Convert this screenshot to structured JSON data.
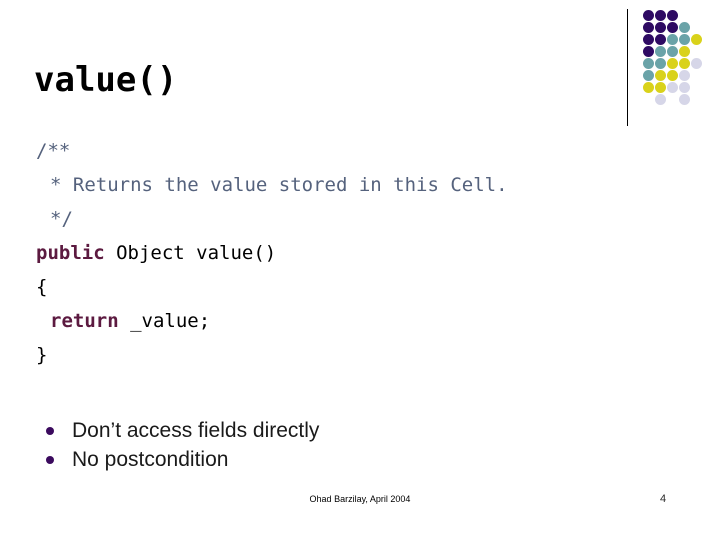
{
  "slide": {
    "title": "value()",
    "code_lines": [
      {
        "indent": 0,
        "tokens": [
          {
            "style": "comment",
            "text": "/**"
          }
        ]
      },
      {
        "indent": 1,
        "tokens": [
          {
            "style": "comment",
            "text": "* Returns the value stored in this Cell."
          }
        ]
      },
      {
        "indent": 1,
        "tokens": [
          {
            "style": "comment",
            "text": "*/"
          }
        ]
      },
      {
        "indent": 0,
        "tokens": [
          {
            "style": "keyword",
            "text": "public"
          },
          {
            "style": "plain",
            "text": " Object value()"
          }
        ]
      },
      {
        "indent": 0,
        "tokens": [
          {
            "style": "plain",
            "text": "{"
          }
        ]
      },
      {
        "indent": 1,
        "tokens": [
          {
            "style": "keyword",
            "text": "return"
          },
          {
            "style": "plain",
            "text": " _value;"
          }
        ]
      },
      {
        "indent": 0,
        "tokens": [
          {
            "style": "plain",
            "text": "}"
          }
        ]
      }
    ],
    "bullets": [
      "Don’t access fields directly",
      "No postcondition"
    ],
    "footer": {
      "credit": "Ohad Barzilay, April 2004",
      "page_number": "4"
    }
  },
  "colors": {
    "keyword": "#5c1a40",
    "comment": "#55627d",
    "text": "#000000",
    "bullet_marker": "#3b0a5e",
    "dot_purple": "#2e0a63",
    "dot_teal": "#6aa3a8",
    "dot_yellow": "#d9d21a",
    "dot_lavender": "#d6d6e8",
    "divider": "#000000",
    "background": "#ffffff"
  },
  "decoration": {
    "name": "dot-grid",
    "rows": 8,
    "cols": 5,
    "cell": 12,
    "dot_size": 11,
    "grid": [
      [
        "purple",
        "purple",
        "purple",
        null,
        null
      ],
      [
        "purple",
        "purple",
        "purple",
        "teal",
        null
      ],
      [
        "purple",
        "purple",
        "teal",
        "teal",
        "yellow"
      ],
      [
        "purple",
        "teal",
        "teal",
        "yellow",
        null
      ],
      [
        "teal",
        "teal",
        "yellow",
        "yellow",
        "lavender"
      ],
      [
        "teal",
        "yellow",
        "yellow",
        "lavender",
        null
      ],
      [
        "yellow",
        "yellow",
        "lavender",
        "lavender",
        null
      ],
      [
        null,
        "lavender",
        null,
        "lavender",
        null
      ]
    ]
  }
}
